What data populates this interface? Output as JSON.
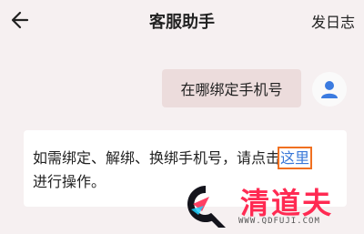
{
  "header": {
    "title": "客服助手",
    "right_action": "发日志"
  },
  "chat": {
    "user_message": "在哪绑定手机号",
    "reply_line1": "如需绑定、解绑、换绑手机号，请点击",
    "reply_link": "这里",
    "reply_line2": "进行操作。"
  },
  "watermark": {
    "brand": "清道夫",
    "url": "WWW.QDFUJI.COM"
  },
  "icons": {
    "back": "back-arrow-icon",
    "avatar": "user-avatar-icon",
    "logo": "q-logo-icon"
  },
  "colors": {
    "background": "#f6f0f1",
    "user_bubble": "#ecdcdc",
    "link": "#3a78d8",
    "highlight_box": "#f07020",
    "watermark": "#ff2a52"
  }
}
